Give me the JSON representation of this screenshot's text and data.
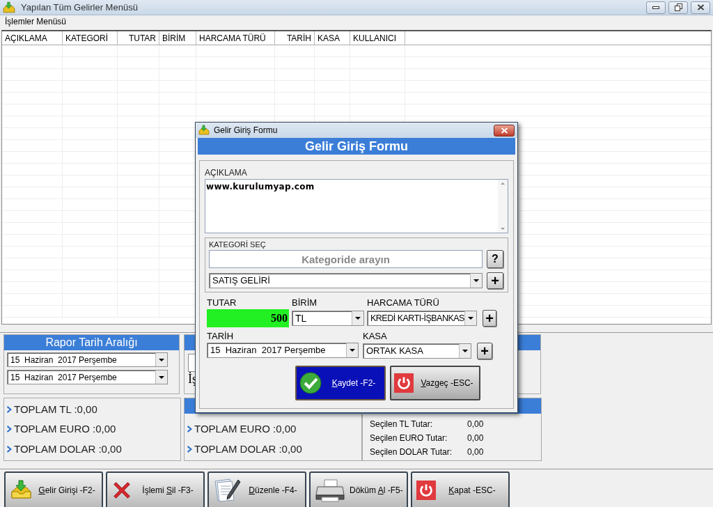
{
  "window": {
    "title": "Yapılan Tüm Gelirler Menüsü"
  },
  "menu": [
    "İşlemler Menüsü"
  ],
  "table": {
    "columns": [
      "AÇIKLAMA",
      "KATEGORİ",
      "TUTAR",
      "BİRİM",
      "HARCAMA TÜRÜ",
      "TARİH",
      "KASA",
      "KULLANICI"
    ]
  },
  "report_range": {
    "title": "Rapor Tarih Aralığı",
    "dates": [
      "15  Haziran  2017 Perşembe",
      "15  Haziran  2017 Perşembe"
    ]
  },
  "filter_panel": {
    "partial_label": "İş"
  },
  "totals_left": [
    "TOPLAM TL :0,00",
    "TOPLAM EURO :0,00",
    "TOPLAM DOLAR :0,00"
  ],
  "totals_middle": [
    "TOPLAM EURO :0,00",
    "TOPLAM DOLAR :0,00"
  ],
  "selected_totals": [
    {
      "label": "Seçilen TL Tutar:",
      "value": "0,00"
    },
    {
      "label": "Seçilen EURO Tutar:",
      "value": "0,00"
    },
    {
      "label": "Seçilen DOLAR Tutar:",
      "value": "0,00"
    }
  ],
  "toolbar": [
    {
      "key": "G",
      "after": "elir Girişi -F2-"
    },
    {
      "before": "İşlemi ",
      "key": "S",
      "after": "il -F3-"
    },
    {
      "key": "D",
      "after": "üzenle -F4-"
    },
    {
      "before": "Döküm ",
      "key": "A",
      "after": "l -F5-"
    },
    {
      "key": "K",
      "after": "apat -ESC-"
    }
  ],
  "dialog": {
    "title": "Gelir Giriş Formu",
    "heading": "Gelir Giriş Formu",
    "description": {
      "label": "AÇIKLAMA",
      "value": "www.kurulumyap.com"
    },
    "category": {
      "label": "KATEGORİ SEÇ",
      "placeholder": "Kategoride arayın",
      "help": "?",
      "value": "SATIŞ GELİRİ",
      "add": "+"
    },
    "amount": {
      "label": "TUTAR",
      "value": "500"
    },
    "currency": {
      "label": "BİRİM",
      "value": "TL"
    },
    "payment_type": {
      "label": "HARCAMA TÜRÜ",
      "value": "KREDİ KARTI-İŞBANKAS",
      "add": "+"
    },
    "date": {
      "label": "TARİH",
      "value": "15  Haziran  2017 Perşembe"
    },
    "cash": {
      "label": "KASA",
      "value": "ORTAK KASA",
      "add": "+"
    },
    "buttons": [
      {
        "key": "K",
        "after": "aydet -F2-"
      },
      {
        "key": "V",
        "after": "azgeç -ESC-"
      }
    ]
  }
}
